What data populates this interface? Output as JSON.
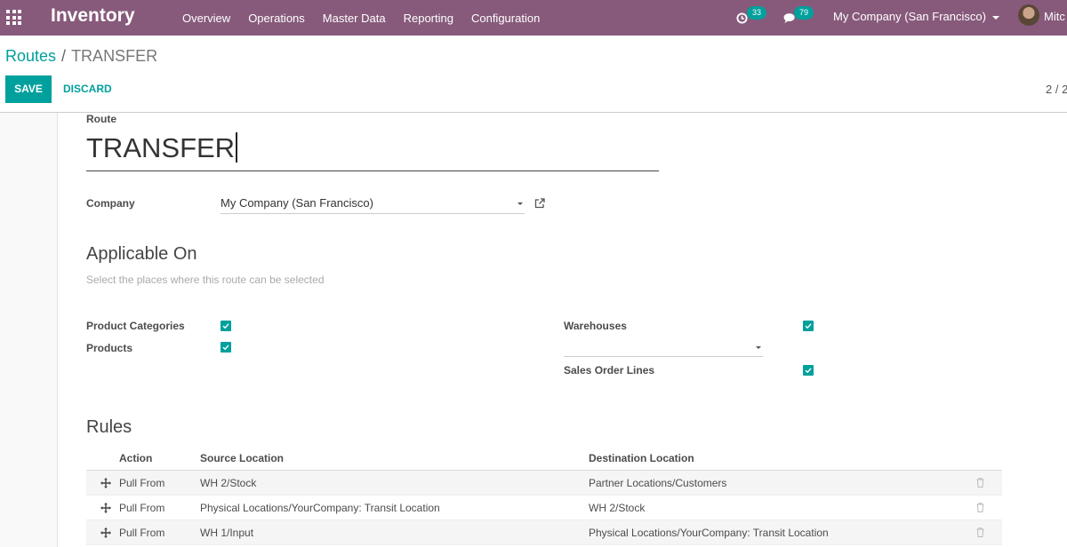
{
  "navbar": {
    "brand": "Inventory",
    "menu": [
      "Overview",
      "Operations",
      "Master Data",
      "Reporting",
      "Configuration"
    ],
    "activity_count": "33",
    "message_count": "79",
    "company": "My Company (San Francisco)",
    "user": "Mitc"
  },
  "breadcrumb": {
    "parent": "Routes",
    "separator": "/",
    "current": "TRANSFER"
  },
  "buttons": {
    "save": "SAVE",
    "discard": "DISCARD"
  },
  "pager": "2 / 2",
  "form": {
    "route_label": "Route",
    "route_value": "TRANSFER",
    "company_label": "Company",
    "company_value": "My Company (San Francisco)",
    "applicable_title": "Applicable On",
    "applicable_help": "Select the places where this route can be selected",
    "product_categories_label": "Product Categories",
    "products_label": "Products",
    "warehouses_label": "Warehouses",
    "sales_order_lines_label": "Sales Order Lines",
    "product_categories_checked": true,
    "products_checked": true,
    "warehouses_checked": true,
    "sales_order_lines_checked": true,
    "rules_title": "Rules"
  },
  "rules": {
    "headers": [
      "Action",
      "Source Location",
      "Destination Location"
    ],
    "rows": [
      {
        "action": "Pull From",
        "source": "WH 2/Stock",
        "destination": "Partner Locations/Customers"
      },
      {
        "action": "Pull From",
        "source": "Physical Locations/YourCompany: Transit Location",
        "destination": "WH 2/Stock"
      },
      {
        "action": "Pull From",
        "source": "WH 1/Input",
        "destination": "Physical Locations/YourCompany: Transit Location"
      }
    ]
  },
  "colors": {
    "navbar": "#875a7b",
    "accent": "#00a09d"
  }
}
